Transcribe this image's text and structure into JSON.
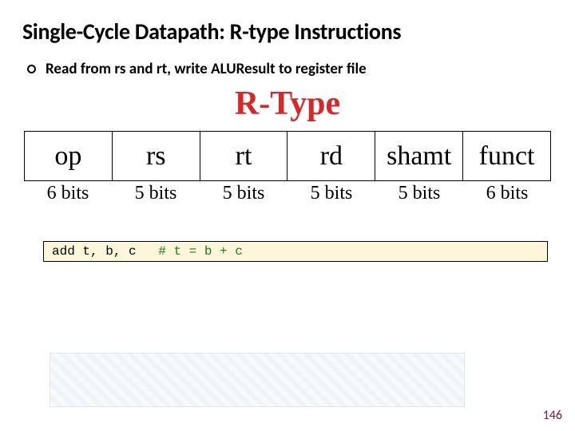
{
  "slide": {
    "title": "Single-Cycle Datapath: R-type Instructions",
    "bullet": "Read from rs and rt,  write ALUResult to register file",
    "rtype_heading": "R-Type",
    "fields": {
      "names": [
        "op",
        "rs",
        "rt",
        "rd",
        "shamt",
        "funct"
      ],
      "bits": [
        "6 bits",
        "5 bits",
        "5 bits",
        "5 bits",
        "5 bits",
        "6 bits"
      ]
    },
    "code": {
      "instr": "add t, b, c",
      "comment": "# t = b + c"
    },
    "page_number": "146",
    "colors": {
      "rtype_red": "#d62828",
      "code_bg": "#fdf6d8",
      "comment_green": "#1a7f1a",
      "accent": "#8a1538"
    }
  }
}
